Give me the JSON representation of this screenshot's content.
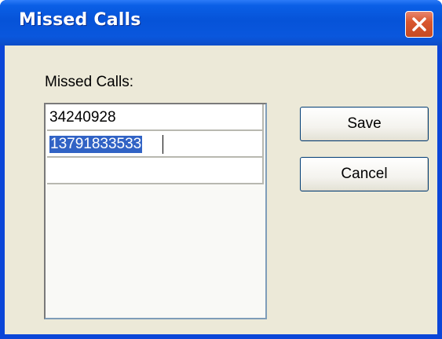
{
  "window": {
    "title": "Missed Calls"
  },
  "dialog": {
    "list_label": "Missed Calls:",
    "entries": [
      "34240928",
      "13791833533",
      ""
    ],
    "selected_index": 1
  },
  "buttons": {
    "save_label": "Save",
    "cancel_label": "Cancel"
  },
  "icons": {
    "close": "close-icon"
  },
  "colors": {
    "titlebar": "#0653d8",
    "close_button": "#d9572f",
    "client_background": "#ece9d8",
    "selection": "#3163c5"
  }
}
